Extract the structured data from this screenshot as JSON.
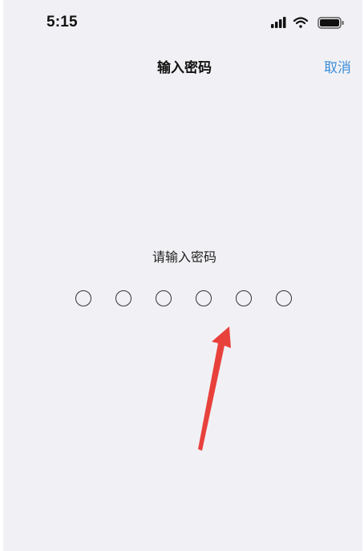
{
  "status_bar": {
    "time": "5:15",
    "icons": [
      "signal-icon",
      "wifi-icon",
      "battery-icon"
    ]
  },
  "nav": {
    "title": "输入密码",
    "cancel_label": "取消"
  },
  "prompt": "请输入密码",
  "passcode": {
    "length": 6,
    "entered": 0
  },
  "colors": {
    "background": "#f1f1f5",
    "accent": "#3b8ed8",
    "arrow": "#e8413c"
  }
}
